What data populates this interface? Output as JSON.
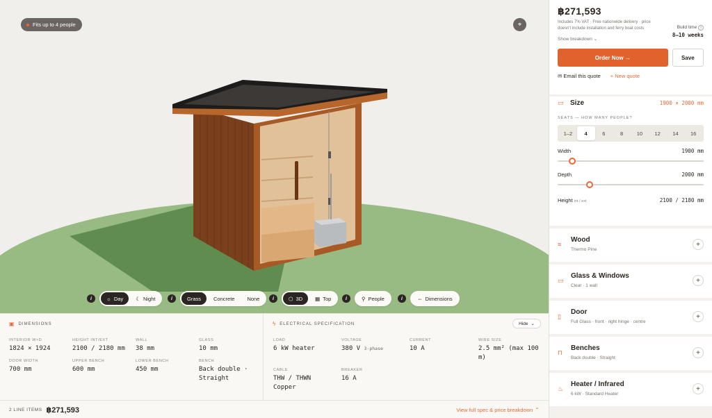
{
  "viewport": {
    "capacity_chip": "Fits up to 4 people",
    "toolbar": {
      "info": "i",
      "time": [
        "Day",
        "Night"
      ],
      "ground": [
        "Grass",
        "Concrete",
        "None"
      ],
      "view": [
        "3D",
        "Top"
      ],
      "people": "People",
      "dimensions": "Dimensions"
    }
  },
  "dimensions": {
    "heading": "DIMENSIONS",
    "specs": [
      {
        "k": "INTERIOR W×D",
        "v": "1824 × 1924"
      },
      {
        "k": "HEIGHT INT/EXT",
        "v": "2100 / 2180 mm"
      },
      {
        "k": "WALL",
        "v": "38 mm"
      },
      {
        "k": "GLASS",
        "v": "10 mm"
      },
      {
        "k": "DOOR WIDTH",
        "v": "700 mm"
      },
      {
        "k": "UPPER BENCH",
        "v": "600 mm"
      },
      {
        "k": "LOWER BENCH",
        "v": "450 mm"
      },
      {
        "k": "BENCH",
        "v": "Back double · Straight"
      }
    ]
  },
  "electrical": {
    "heading": "ELECTRICAL SPECIFICATION",
    "hide_label": "Hide",
    "specs": [
      {
        "k": "LOAD",
        "v": "6 kW heater"
      },
      {
        "k": "VOLTAGE",
        "v": "380 V",
        "note": "3-phase"
      },
      {
        "k": "CURRENT",
        "v": "10 A"
      },
      {
        "k": "WIRE SIZE",
        "v": "2.5 mm² (max 100 m)"
      },
      {
        "k": "CABLE",
        "v": "THW / THWN Copper"
      },
      {
        "k": "BREAKER",
        "v": "16 A"
      }
    ]
  },
  "footer": {
    "line_items": "2 LINE ITEMS",
    "total": "฿271,593",
    "link": "View full spec & price breakdown"
  },
  "sidebar": {
    "price": "฿271,593",
    "vat_note": "Includes 7% VAT · Free nationwide delivery · price doesn't include installation and ferry boat costs",
    "build_time_label": "Build time",
    "build_time_value": "8–10 weeks",
    "show_breakdown": "Show breakdown",
    "order_label": "Order Now",
    "save_label": "Save",
    "email_quote": "Email this quote",
    "new_quote": "New quote",
    "size": {
      "title": "Size",
      "summary": "1900 × 2000 mm",
      "seats_label": "SEATS — HOW MANY PEOPLE?",
      "seats": [
        "1–2",
        "4",
        "6",
        "8",
        "10",
        "12",
        "14",
        "16"
      ],
      "selected_seat": "4",
      "width_label": "Width",
      "width_value": "1900 mm",
      "width_level": 0.1,
      "depth_label": "Depth",
      "depth_value": "2000 mm",
      "depth_level": 0.22,
      "height_label": "Height",
      "height_note": "int / ext",
      "height_value": "2100 / 2180 mm"
    },
    "options": [
      {
        "title": "Wood",
        "sub": "Thermo Pine",
        "icon": "wood-icon"
      },
      {
        "title": "Glass & Windows",
        "sub": "Clear · 1 wall",
        "icon": "window-icon"
      },
      {
        "title": "Door",
        "sub": "Full Glass · front · right hinge · centre",
        "icon": "door-icon"
      },
      {
        "title": "Benches",
        "sub": "Back double · Straight",
        "icon": "bench-icon"
      },
      {
        "title": "Heater / Infrared",
        "sub": "6 kW · Standard Heater",
        "icon": "flame-icon"
      }
    ]
  }
}
